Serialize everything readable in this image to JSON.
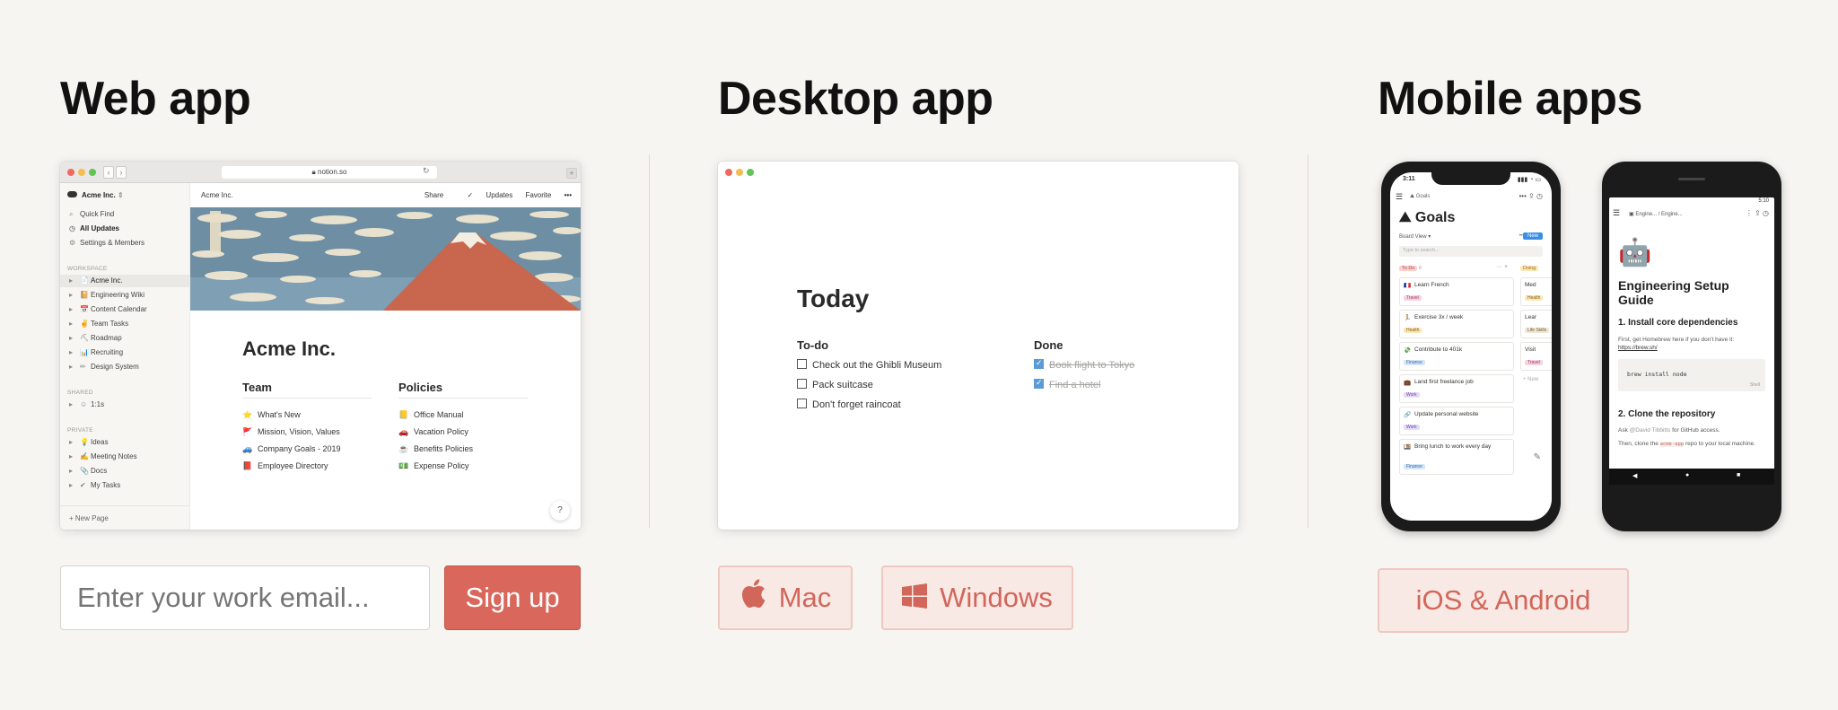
{
  "web": {
    "heading": "Web app",
    "url": "notion.so",
    "workspace": "Acme Inc.",
    "breadcrumb": "Acme Inc.",
    "topbar": [
      "Share",
      "Updates",
      "Favorite",
      "•••"
    ],
    "sidebar": {
      "top_items": [
        "Quick Find",
        "All Updates",
        "Settings & Members"
      ],
      "workspace_label": "WORKSPACE",
      "workspace_items": [
        "Acme Inc.",
        "Engineering Wiki",
        "Content Calendar",
        "Team Tasks",
        "Roadmap",
        "Recruiting",
        "Design System"
      ],
      "shared_label": "SHARED",
      "shared_items": [
        "1:1s"
      ],
      "private_label": "PRIVATE",
      "private_items": [
        "Ideas",
        "Meeting Notes",
        "Docs",
        "My Tasks"
      ],
      "new_page": "New Page"
    },
    "page_title": "Acme Inc.",
    "team": {
      "heading": "Team",
      "items": [
        {
          "emoji": "⭐",
          "label": "What's New"
        },
        {
          "emoji": "🚩",
          "label": "Mission, Vision, Values"
        },
        {
          "emoji": "🚙",
          "label": "Company Goals - 2019"
        },
        {
          "emoji": "📕",
          "label": "Employee Directory"
        }
      ]
    },
    "policies": {
      "heading": "Policies",
      "items": [
        {
          "emoji": "📒",
          "label": "Office Manual"
        },
        {
          "emoji": "🚗",
          "label": "Vacation Policy"
        },
        {
          "emoji": "☕",
          "label": "Benefits Policies"
        },
        {
          "emoji": "💵",
          "label": "Expense Policy"
        }
      ]
    },
    "help": "?",
    "email_placeholder": "Enter your work email...",
    "signup": "Sign up"
  },
  "desktop": {
    "heading": "Desktop app",
    "title": "Today",
    "todo_heading": "To-do",
    "todo": [
      "Check out the Ghibli Museum",
      "Pack suitcase",
      "Don't forget raincoat"
    ],
    "done_heading": "Done",
    "done": [
      "Book flight to Tokyo",
      "Find a hotel"
    ],
    "mac": "Mac",
    "windows": "Windows"
  },
  "mobile": {
    "heading": "Mobile apps",
    "iphone": {
      "time": "3:11",
      "crumb": "Goals",
      "title": "Goals",
      "view": "Board View ▾",
      "new": "New",
      "search": "Type to search...",
      "col_todo": "To Do",
      "col_todo_count": "6",
      "col_doing": "Doing",
      "cards": [
        {
          "emoji": "🇫🇷",
          "text": "Learn French",
          "tag": "Travel"
        },
        {
          "emoji": "🏃",
          "text": "Exercise 3x / week",
          "tag": "Health"
        },
        {
          "emoji": "💸",
          "text": "Contribute to 401k",
          "tag": "Finance"
        },
        {
          "emoji": "💼",
          "text": "Land first freelance job",
          "tag": "Work"
        },
        {
          "emoji": "🔗",
          "text": "Update personal website",
          "tag": "Work"
        },
        {
          "emoji": "🍱",
          "text": "Bring lunch to work every day",
          "tag": "Finance"
        }
      ],
      "doing_cards": [
        {
          "text": "Med",
          "tag": "Health"
        },
        {
          "text": "Lear",
          "tag": "Life Skills"
        },
        {
          "text": "Visit",
          "tag": "Travel"
        }
      ],
      "add_new": "+ New"
    },
    "android": {
      "time": "5:10",
      "crumb1": "Engine...",
      "crumb2": "Engine...",
      "title": "Engineering Setup Guide",
      "step1": "1. Install core dependencies",
      "step1_text": "First, get Homebrew here if you don't have it:",
      "step1_link": "https://brew.sh/",
      "code": "brew install node",
      "code_lang": "Shell",
      "step2": "2. Clone the repository",
      "step2_text_a": "Ask",
      "step2_mention": "@David Tibbitts",
      "step2_text_b": "for GitHub access.",
      "step2_text_c": "Then, clone the",
      "step2_code": "acme-app",
      "step2_text_d": "repo to your local machine."
    },
    "button": "iOS & Android"
  },
  "colors": {
    "background": "#f7f5f2",
    "accent": "#d9675c",
    "accent_light": "#f8e9e4",
    "accent_border": "#efc8c0"
  }
}
